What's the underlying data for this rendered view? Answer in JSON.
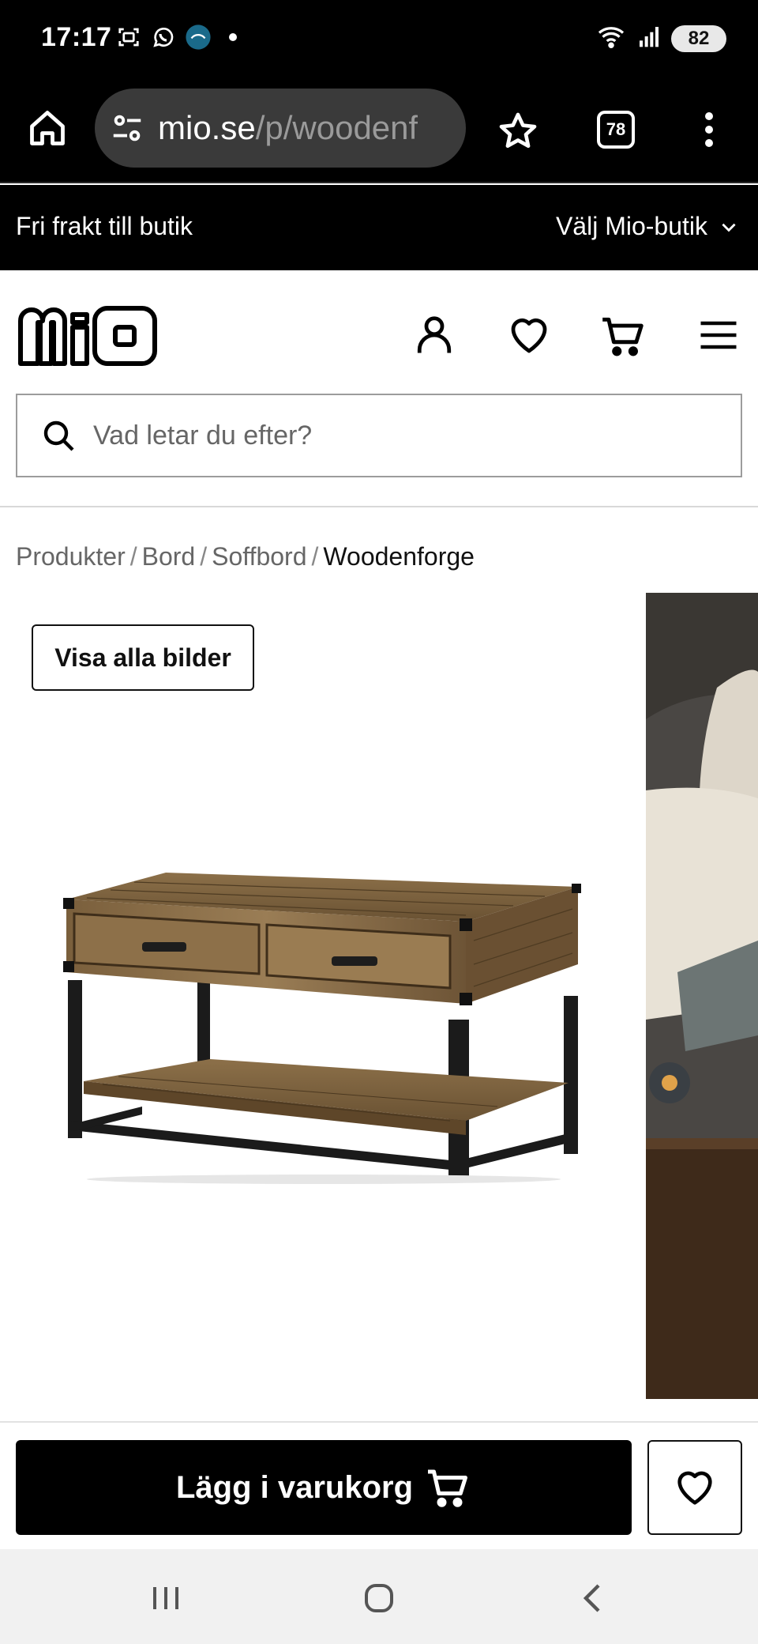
{
  "status_bar": {
    "time": "17:17",
    "battery": "82",
    "left_icons": [
      "screenshot-icon",
      "whatsapp-icon",
      "disney-plus-icon"
    ],
    "right_icons": [
      "wifi-icon",
      "signal-icon",
      "battery-icon"
    ]
  },
  "browser": {
    "url_domain": "mio.se",
    "url_path": "/p/woodenf",
    "tab_count": "78"
  },
  "promo": {
    "left_text": "Fri frakt till butik",
    "store_select": "Välj Mio-butik"
  },
  "header": {
    "logo_text": "mio",
    "icons": [
      "account-icon",
      "heart-icon",
      "cart-icon",
      "hamburger-menu-icon"
    ]
  },
  "search": {
    "placeholder": "Vad letar du efter?",
    "value": ""
  },
  "breadcrumb": {
    "items": [
      "Produkter",
      "Bord",
      "Soffbord"
    ],
    "current": "Woodenforge",
    "separator": "/"
  },
  "gallery": {
    "show_all_label": "Visa alla bilder"
  },
  "buy_bar": {
    "add_to_cart_label": "Lägg i varukorg"
  },
  "colors": {
    "brand_black": "#000000",
    "url_pill": "#3a3a3a",
    "nav_bar": "#f1f1f1"
  }
}
